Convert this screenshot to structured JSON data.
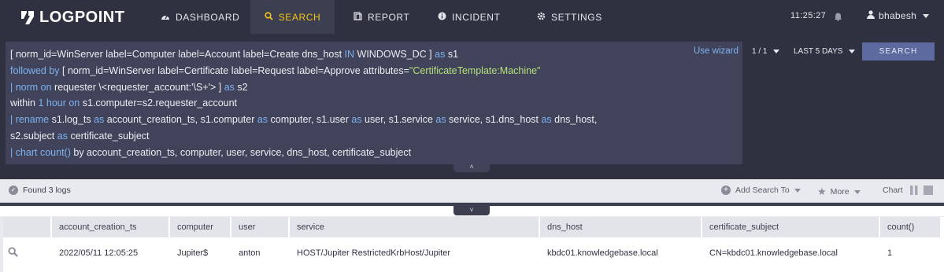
{
  "nav": {
    "logo": "LOGPOINT",
    "items": [
      {
        "label": "DASHBOARD",
        "icon": "speedometer-icon"
      },
      {
        "label": "SEARCH",
        "icon": "search-icon"
      },
      {
        "label": "REPORT",
        "icon": "report-icon"
      },
      {
        "label": "INCIDENT",
        "icon": "info-icon"
      },
      {
        "label": "SETTINGS",
        "icon": "gear-icon"
      }
    ],
    "active": "SEARCH",
    "time": "11:25:27",
    "user": "bhabesh",
    "accent_color": "#f5c518"
  },
  "query": {
    "use_wizard": "Use wizard",
    "page": "1 / 1",
    "time_range": "LAST 5 DAYS",
    "search_button": "SEARCH"
  },
  "results": {
    "found": "Found 3 logs",
    "add_search": "Add Search To",
    "more": "More",
    "chart": "Chart"
  },
  "table": {
    "headers": [
      "account_creation_ts",
      "computer",
      "user",
      "service",
      "dns_host",
      "certificate_subject",
      "count()"
    ],
    "rows": [
      [
        "2022/05/11 12:05:25",
        "Jupiter$",
        "anton",
        "HOST/Jupiter RestrictedKrbHost/Jupiter",
        "kbdc01.knowledgebase.local",
        "CN=kbdc01.knowledgebase.local",
        "1"
      ]
    ]
  }
}
